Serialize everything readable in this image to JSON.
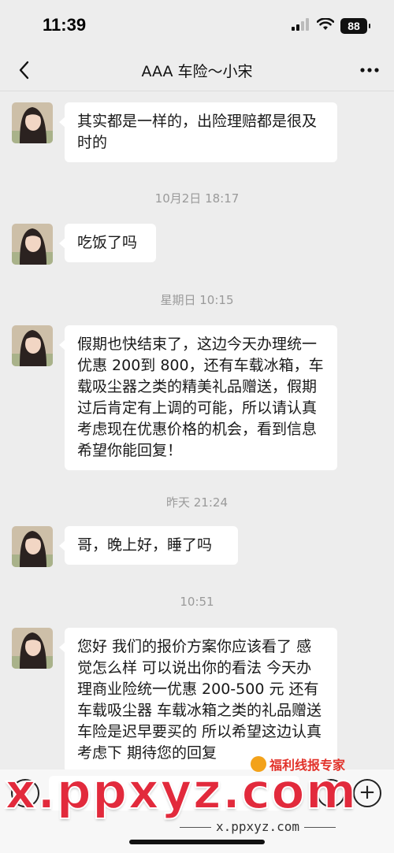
{
  "status_bar": {
    "time": "11:39",
    "battery": "88",
    "signal_icon": "cellular-signal-icon",
    "wifi_icon": "wifi-icon"
  },
  "nav": {
    "title": "AAA 车险～小宋",
    "back_icon": "chevron-left-icon",
    "more_icon": "more-dots-icon"
  },
  "messages": [
    {
      "type": "received",
      "text": "其实都是一样的，出险理赔都是很及时的"
    },
    {
      "type": "timestamp",
      "text": "10月2日 18:17"
    },
    {
      "type": "received",
      "text": "吃饭了吗"
    },
    {
      "type": "timestamp",
      "text": "星期日 10:15"
    },
    {
      "type": "received",
      "text": "假期也快结束了，这边今天办理统一优惠 200到 800，还有车载冰箱，车载吸尘器之类的精美礼品赠送，假期过后肯定有上调的可能，所以请认真考虑现在优惠价格的机会，看到信息希望你能回复！"
    },
    {
      "type": "timestamp",
      "text": "昨天 21:24"
    },
    {
      "type": "received",
      "text": "哥，晚上好，睡了吗"
    },
    {
      "type": "timestamp",
      "text": "10:51"
    },
    {
      "type": "received",
      "text": "您好 我们的报价方案你应该看了 感觉怎么样 可以说出你的看法 今天办理商业险统一优惠 200-500 元 还有 车载吸尘器 车载冰箱之类的礼品赠送 车险是迟早要买的 所以希望这边认真考虑下 期待您的回复"
    }
  ],
  "watermark": {
    "site": "x.ppxyz.com",
    "badge": "福利线报专家",
    "url": "x.ppxyz.com"
  },
  "colors": {
    "background": "#ededed",
    "bubble": "#ffffff",
    "watermark_red": "#e22a3c"
  }
}
